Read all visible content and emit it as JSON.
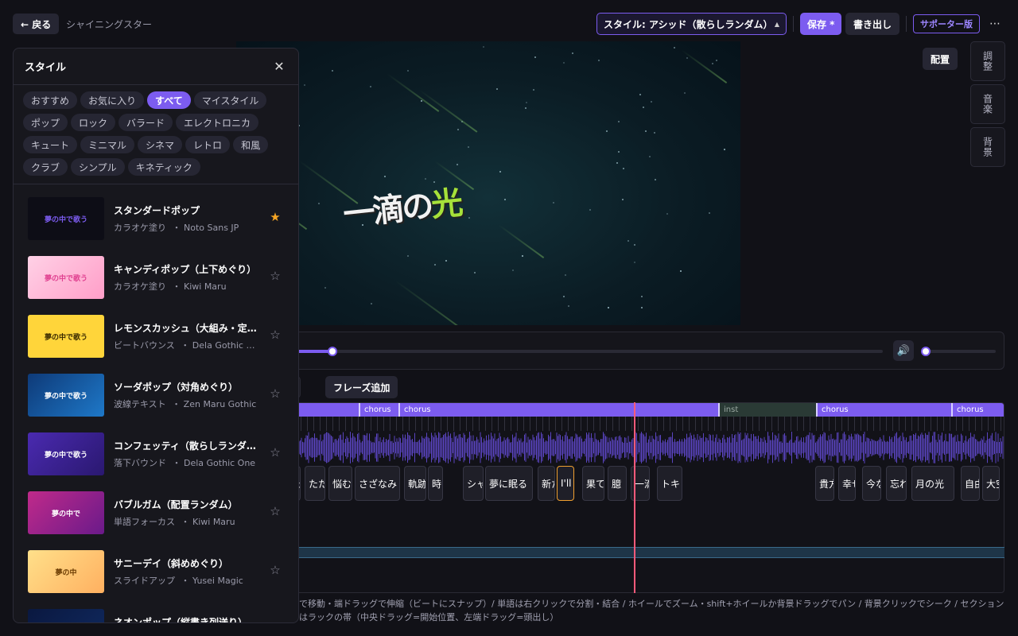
{
  "topbar": {
    "back_label": "← 戻る",
    "song_title": "シャイニングスター",
    "style_select_label": "スタイル: アシッド（散らしランダム）",
    "save_label": "保存 *",
    "export_label": "書き出し",
    "supporter_label": "サポーター版",
    "more_label": "⋯"
  },
  "preview": {
    "lyric_main": "一滴の",
    "lyric_highlight": "光"
  },
  "right_panel": {
    "layout_label": "配置",
    "tabs": [
      "調整",
      "音楽",
      "背景"
    ]
  },
  "transport": {
    "progress_fraction": 0.08,
    "volume_fraction": 0.0,
    "volume_icon": "🔊"
  },
  "timeline_buttons": {
    "loop_label": "ープ",
    "add_phrase_label": "フレーズ追加"
  },
  "sections": [
    {
      "label": "chorus"
    },
    {
      "label": "chorus"
    },
    {
      "label": "inst"
    },
    {
      "label": "chorus"
    },
    {
      "label": "chorus"
    }
  ],
  "words": [
    "た",
    "たた",
    "悩む",
    "さざなみ",
    "軌跡",
    "時",
    "シャ",
    "夢に眠る",
    "新た",
    "I'll",
    "果て",
    "臆",
    "一滴",
    "トキ",
    "貴方",
    "幸せ",
    "今な",
    "忘れ",
    "月の光",
    "自由",
    "大空"
  ],
  "help_text": "で移動・端ドラッグで伸縮（ビートにスナップ）/ 単語は右クリックで分割・結合 / ホイールでズーム・shift+ホイールか背景ドラッグでパン / 背景クリックでシーク / セクションはラックの帯（中央ドラッグ=開始位置、左端ドラッグ=頭出し）",
  "style_panel": {
    "title": "スタイル",
    "close_label": "✕",
    "chips": [
      {
        "label": "おすすめ"
      },
      {
        "label": "お気に入り"
      },
      {
        "label": "すべて"
      },
      {
        "label": "マイスタイル"
      },
      {
        "label": "ポップ"
      },
      {
        "label": "ロック"
      },
      {
        "label": "バラード"
      },
      {
        "label": "エレクトロニカ"
      },
      {
        "label": "キュート"
      },
      {
        "label": "ミニマル"
      },
      {
        "label": "シネマ"
      },
      {
        "label": "レトロ"
      },
      {
        "label": "和風"
      },
      {
        "label": "クラブ"
      },
      {
        "label": "シンプル"
      },
      {
        "label": "キネティック"
      }
    ],
    "active_chip": "すべて",
    "items": [
      {
        "name": "スタンダードポップ",
        "effect": "カラオケ塗り",
        "font": "Noto Sans JP",
        "thumb_text": "夢の中で歌う",
        "favorite": true
      },
      {
        "name": "キャンディポップ（上下めぐり）",
        "effect": "カラオケ塗り",
        "font": "Kiwi Maru",
        "thumb_text": "夢の中で歌う",
        "favorite": false
      },
      {
        "name": "レモンスカッシュ（大組み・定位置）",
        "effect": "ビートバウンス",
        "font": "Dela Gothic One",
        "thumb_text": "夢の中で歌う",
        "favorite": false
      },
      {
        "name": "ソーダポップ（対角めぐり）",
        "effect": "波線テキスト",
        "font": "Zen Maru Gothic",
        "thumb_text": "夢の中で歌う",
        "favorite": false
      },
      {
        "name": "コンフェッティ（散らしランダム）",
        "effect": "落下バウンド",
        "font": "Dela Gothic One",
        "thumb_text": "夢の中で歌う",
        "favorite": false
      },
      {
        "name": "バブルガム（配置ランダム）",
        "effect": "単語フォーカス",
        "font": "Kiwi Maru",
        "thumb_text": "夢の中で",
        "favorite": false
      },
      {
        "name": "サニーデイ（斜めめぐり）",
        "effect": "スライドアップ",
        "font": "Yusei Magic",
        "thumb_text": "夢の中",
        "favorite": false
      },
      {
        "name": "ネオンポップ（縦書き列送り）",
        "effect": "",
        "font": "",
        "thumb_text": "",
        "favorite": false
      }
    ]
  },
  "colors": {
    "accent": "#7c5cf0",
    "playhead": "#ff5a7a",
    "favorite": "#f5a524",
    "lyric_highlight": "#a6e13a"
  }
}
